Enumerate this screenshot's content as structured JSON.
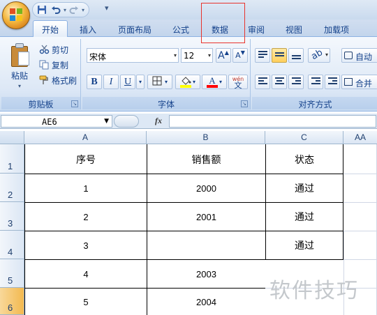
{
  "quick_access": {
    "more_glyph": "▾"
  },
  "tabs": [
    {
      "label": "开始",
      "active": true
    },
    {
      "label": "插入"
    },
    {
      "label": "页面布局"
    },
    {
      "label": "公式"
    },
    {
      "label": "数据",
      "highlighted": true
    },
    {
      "label": "审阅"
    },
    {
      "label": "视图"
    },
    {
      "label": "加载项"
    }
  ],
  "clipboard": {
    "paste_label": "粘贴",
    "cut_label": "剪切",
    "copy_label": "复制",
    "format_painter_label": "格式刷",
    "group_label": "剪贴板"
  },
  "font": {
    "font_name": "宋体",
    "font_size": "12",
    "grow_label": "A",
    "shrink_label": "A",
    "bold_label": "B",
    "italic_label": "I",
    "underline_label": "U",
    "phonetic_label": "wén",
    "phonetic_char": "文",
    "group_label": "字体",
    "fill_color": "#ffff00",
    "font_color": "#ff0000"
  },
  "alignment": {
    "wrap_label": "自动",
    "merge_label": "合并",
    "group_label": "对齐方式"
  },
  "formula_bar": {
    "name_box": "AE6",
    "fx_label": "fx",
    "formula": ""
  },
  "sheet": {
    "columns": [
      "A",
      "B",
      "C",
      "AA"
    ],
    "rows": [
      "1",
      "2",
      "3",
      "4",
      "5",
      "6"
    ],
    "selected_row": "6",
    "header": [
      "序号",
      "销售额",
      "状态"
    ],
    "data": [
      [
        "1",
        "2000",
        "通过"
      ],
      [
        "2",
        "2001",
        "通过"
      ],
      [
        "3",
        "",
        "通过"
      ],
      [
        "4",
        "2003",
        ""
      ],
      [
        "5",
        "2004",
        ""
      ]
    ]
  },
  "watermark": "软件技巧"
}
